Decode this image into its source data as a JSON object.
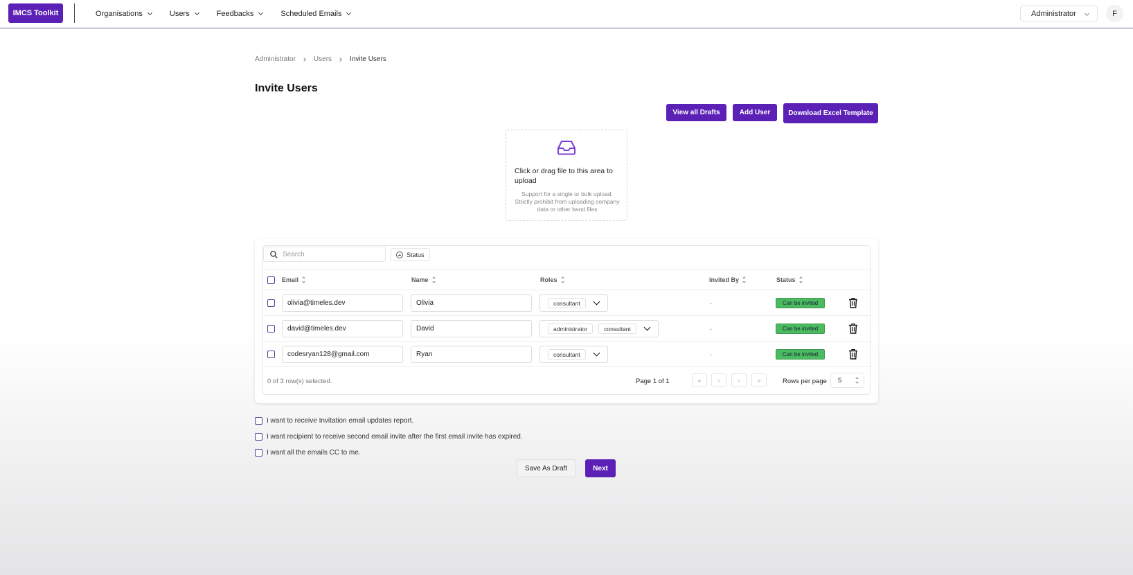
{
  "app": {
    "brand": "IMCS Toolkit"
  },
  "nav": {
    "items": [
      {
        "label": "Organisations"
      },
      {
        "label": "Users"
      },
      {
        "label": "Feedbacks"
      },
      {
        "label": "Scheduled Emails"
      }
    ],
    "role_selected": "Administrator",
    "avatar_initial": "F"
  },
  "breadcrumb": [
    "Administrator",
    "Users",
    "Invite Users"
  ],
  "page": {
    "title": "Invite Users",
    "actions": {
      "view_drafts": "View all Drafts",
      "add_user": "Add User",
      "download_template": "Download Excel Template"
    }
  },
  "upload": {
    "title": "Click or drag file to this area to upload",
    "hint": "Support for a single or bulk upload. Strictly prohibit from uploading company data or other band files"
  },
  "table": {
    "search_placeholder": "Search",
    "status_filter": "Status",
    "columns": [
      "Email",
      "Name",
      "Roles",
      "Invited By",
      "Status"
    ],
    "rows": [
      {
        "email": "olivia@timeles.dev",
        "name": "Olivia",
        "roles": [
          "consultant"
        ],
        "invited_by": "-",
        "status": "Can be invited"
      },
      {
        "email": "david@timeles.dev",
        "name": "David",
        "roles": [
          "administrator",
          "consultant"
        ],
        "invited_by": "-",
        "status": "Can be invited"
      },
      {
        "email": "codesryan128@gmail.com",
        "name": "Ryan",
        "roles": [
          "consultant"
        ],
        "invited_by": "-",
        "status": "Can be invited"
      }
    ],
    "selection_text": "0 of 3 row(s) selected.",
    "page_text": "Page 1 of 1",
    "rows_per_page_label": "Rows per page",
    "rows_per_page_value": "5"
  },
  "options": [
    "I want to receive Invitation email updates report.",
    "I want recipient to receive second email invite after the first email invite has expired.",
    "I want all the emails CC to me."
  ],
  "buttons": {
    "save_draft": "Save As Draft",
    "next": "Next"
  },
  "colors": {
    "primary": "#5b21b6",
    "status_green": "#4cba61"
  }
}
